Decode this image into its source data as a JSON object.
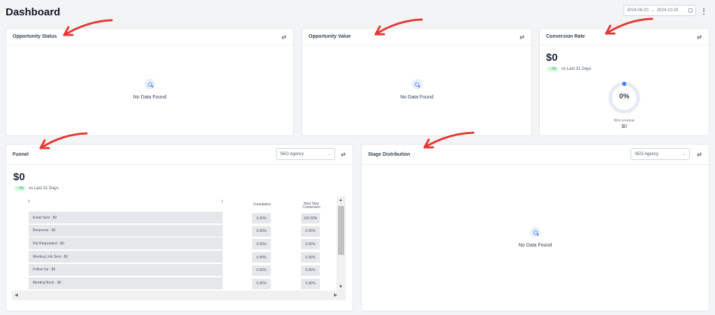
{
  "header": {
    "title": "Dashboard",
    "date_start": "2024-09-20",
    "date_sep": "→",
    "date_end": "2024-10-20"
  },
  "cards": {
    "opportunity_status": {
      "title": "Opportunity Status",
      "empty_text": "No Data Found"
    },
    "opportunity_value": {
      "title": "Opportunity Value",
      "empty_text": "No Data Found"
    },
    "conversion_rate": {
      "title": "Conversion Rate",
      "amount": "$0",
      "trend_pill": "↑ 0%",
      "trend_text": "vs Last 31 Days",
      "gauge_value": "0%",
      "won_label": "Won revenue",
      "won_amount": "$0"
    },
    "funnel": {
      "title": "Funnel",
      "select_value": "SEO Agency",
      "amount": "$0",
      "trend_pill": "↑ 0%",
      "trend_text": "vs Last 31 Days",
      "axis_left": "0",
      "axis_right": "1",
      "col_cumulative": "Cumulative",
      "col_next": "Next Step Conversion",
      "rows": [
        {
          "label": "Email Sent - $0",
          "cumulative": "0.00%",
          "next": "100.00%"
        },
        {
          "label": "Response - $0",
          "cumulative": "0.00%",
          "next": "0.00%"
        },
        {
          "label": "Not Responded - $0",
          "cumulative": "0.00%",
          "next": "0.00%"
        },
        {
          "label": "Meeting Link Sent - $0",
          "cumulative": "0.00%",
          "next": "0.00%"
        },
        {
          "label": "Follow Up - $0",
          "cumulative": "0.00%",
          "next": "0.00%"
        },
        {
          "label": "Meeting Book - $0",
          "cumulative": "0.00%",
          "next": "0.00%"
        }
      ]
    },
    "stage_distribution": {
      "title": "Stage Distribution",
      "select_value": "SEO Agency",
      "empty_text": "No Data Found"
    }
  },
  "colors": {
    "accent": "#3b82f6",
    "annotation_arrow": "#e53935",
    "positive": "#16a34a"
  }
}
